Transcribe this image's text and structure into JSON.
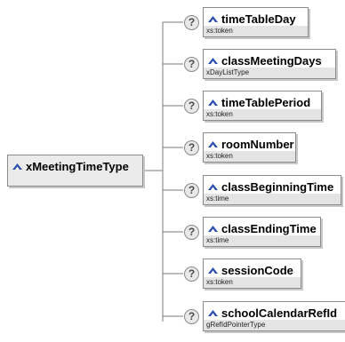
{
  "root": {
    "name": "xMeetingTimeType"
  },
  "help_glyph": "?",
  "elements": [
    {
      "name": "timeTableDay",
      "type": "xs:token"
    },
    {
      "name": "classMeetingDays",
      "type": "xDayListType"
    },
    {
      "name": "timeTablePeriod",
      "type": "xs:token"
    },
    {
      "name": "roomNumber",
      "type": "xs:token"
    },
    {
      "name": "classBeginningTime",
      "type": "xs:time"
    },
    {
      "name": "classEndingTime",
      "type": "xs:time"
    },
    {
      "name": "sessionCode",
      "type": "xs:token"
    },
    {
      "name": "schoolCalendarRefId",
      "type": "gRefIdPointerType"
    }
  ],
  "colors": {
    "icon": "#2a4fb0",
    "line": "#7a7a7a",
    "type_band": "#e4e4e4"
  }
}
